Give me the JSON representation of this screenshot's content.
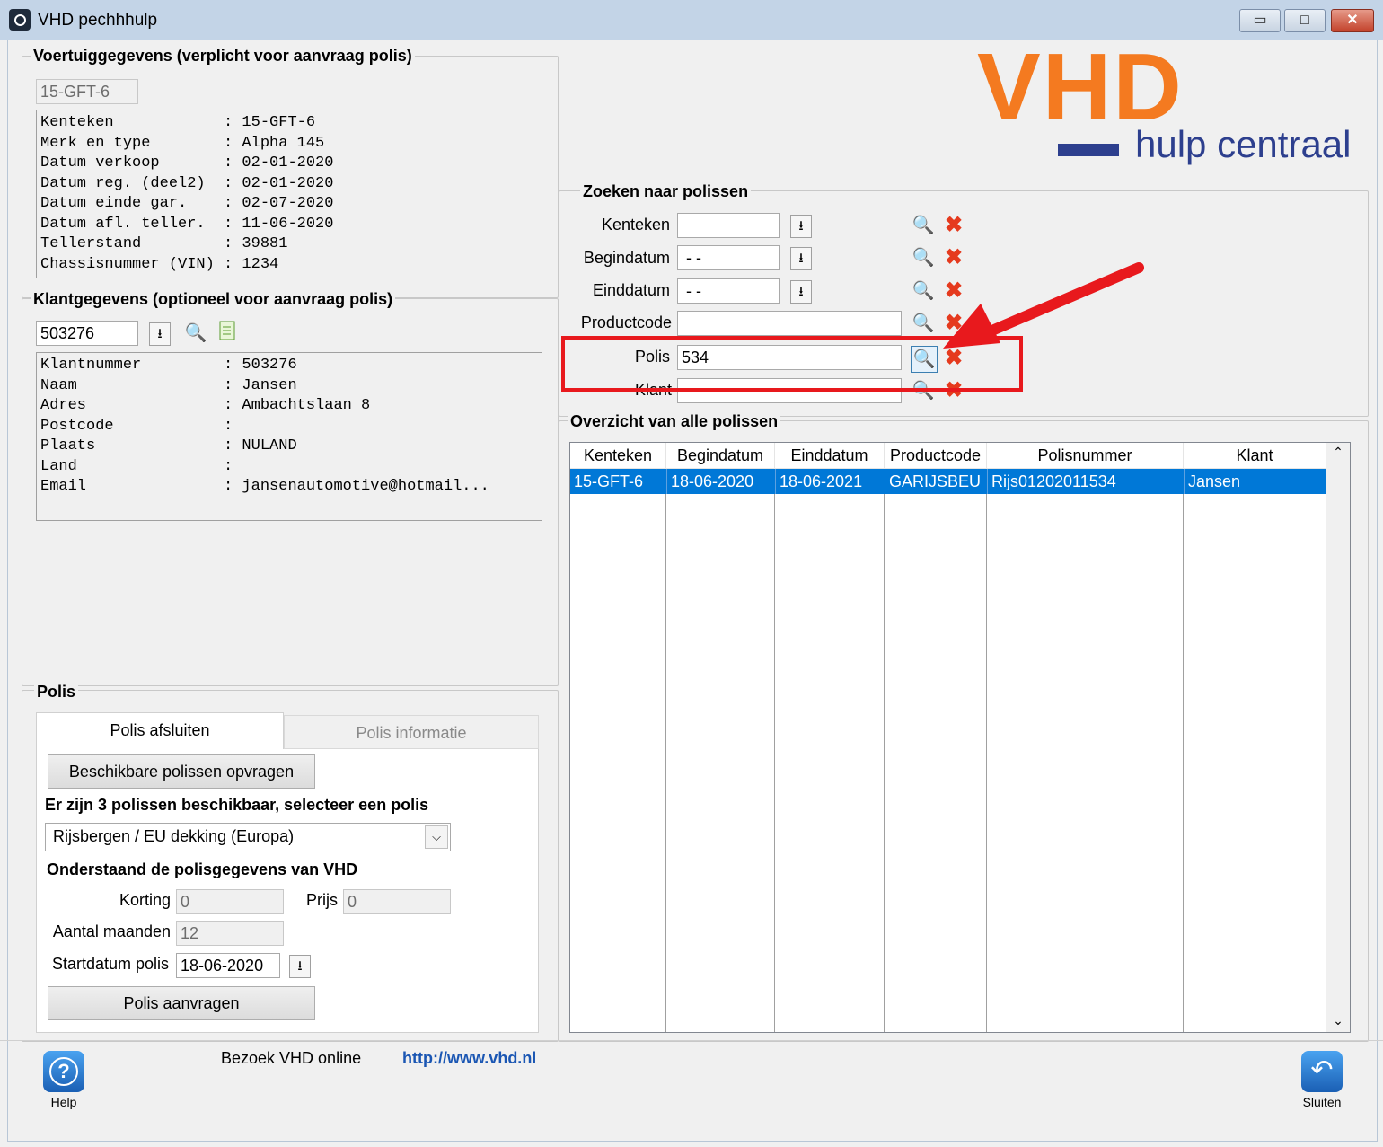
{
  "window": {
    "title": "VHD pechhhulp",
    "buttons": {
      "minimize": "▭",
      "maximize": "□",
      "close": "✕"
    }
  },
  "logo": {
    "brand": "VHD",
    "tagline": "hulp centraal",
    "brand_color": "#f47a20",
    "tagline_color": "#2d3f8e"
  },
  "vehicle": {
    "legend": "Voertuiggegevens (verplicht voor aanvraag polis)",
    "plate_value": "15-GFT-6",
    "lines": [
      "Kenteken            : 15-GFT-6",
      "Merk en type        : Alpha 145",
      "Datum verkoop       : 02-01-2020",
      "Datum reg. (deel2)  : 02-01-2020",
      "Datum einde gar.    : 02-07-2020",
      "Datum afl. teller.  : 11-06-2020",
      "Tellerstand         : 39881",
      "Chassisnummer (VIN) : 1234"
    ]
  },
  "customer": {
    "legend": "Klantgegevens (optioneel voor aanvraag polis)",
    "number_value": "503276",
    "lines": [
      "Klantnummer         : 503276",
      "Naam                : Jansen",
      "Adres               : Ambachtslaan 8",
      "Postcode            :",
      "Plaats              : NULAND",
      "Land                :",
      "Email               : jansenautomotive@hotmail..."
    ]
  },
  "polis": {
    "legend": "Polis",
    "tabs": [
      "Polis afsluiten",
      "Polis informatie"
    ],
    "available_button": "Beschikbare polissen opvragen",
    "available_text": "Er zijn 3 polissen beschikbaar, selecteer een polis",
    "selected_policy": "Rijsbergen / EU dekking (Europa)",
    "details_heading": "Onderstaand de polisgegevens van VHD",
    "korting_label": "Korting",
    "korting_value": "0",
    "prijs_label": "Prijs",
    "prijs_value": "0",
    "maanden_label": "Aantal maanden",
    "maanden_value": "12",
    "startdatum_label": "Startdatum polis",
    "startdatum_value": "18-06-2020",
    "request_button": "Polis aanvragen"
  },
  "search": {
    "legend": "Zoeken naar polissen",
    "kenteken_label": "Kenteken",
    "kenteken_value": "",
    "begindatum_label": "Begindatum",
    "begindatum_value": " - -",
    "einddatum_label": "Einddatum",
    "einddatum_value": " - -",
    "productcode_label": "Productcode",
    "productcode_value": "",
    "polis_label": "Polis",
    "polis_value": "534",
    "klant_label": "Klant",
    "klant_value": ""
  },
  "overview": {
    "legend": "Overzicht van alle polissen",
    "columns": [
      "Kenteken",
      "Begindatum",
      "Einddatum",
      "Productcode",
      "Polisnummer",
      "Klant"
    ],
    "rows": [
      [
        "15-GFT-6",
        "18-06-2020",
        "18-06-2021",
        "GARIJSBEU",
        "Rijs01202011534",
        "Jansen"
      ]
    ],
    "selection_color": "#0078d7"
  },
  "footer": {
    "visit_text": "Bezoek VHD online",
    "url": "http://www.vhd.nl",
    "help_label": "Help",
    "close_label": "Sluiten"
  },
  "annotation": {
    "color": "#e8191d"
  },
  "icons": [
    "app-icon",
    "download-icon",
    "search-icon",
    "clear-icon",
    "note-icon",
    "help-icon",
    "undo-icon",
    "scroll-up-icon",
    "scroll-down-icon",
    "dropdown-arrow-icon"
  ]
}
